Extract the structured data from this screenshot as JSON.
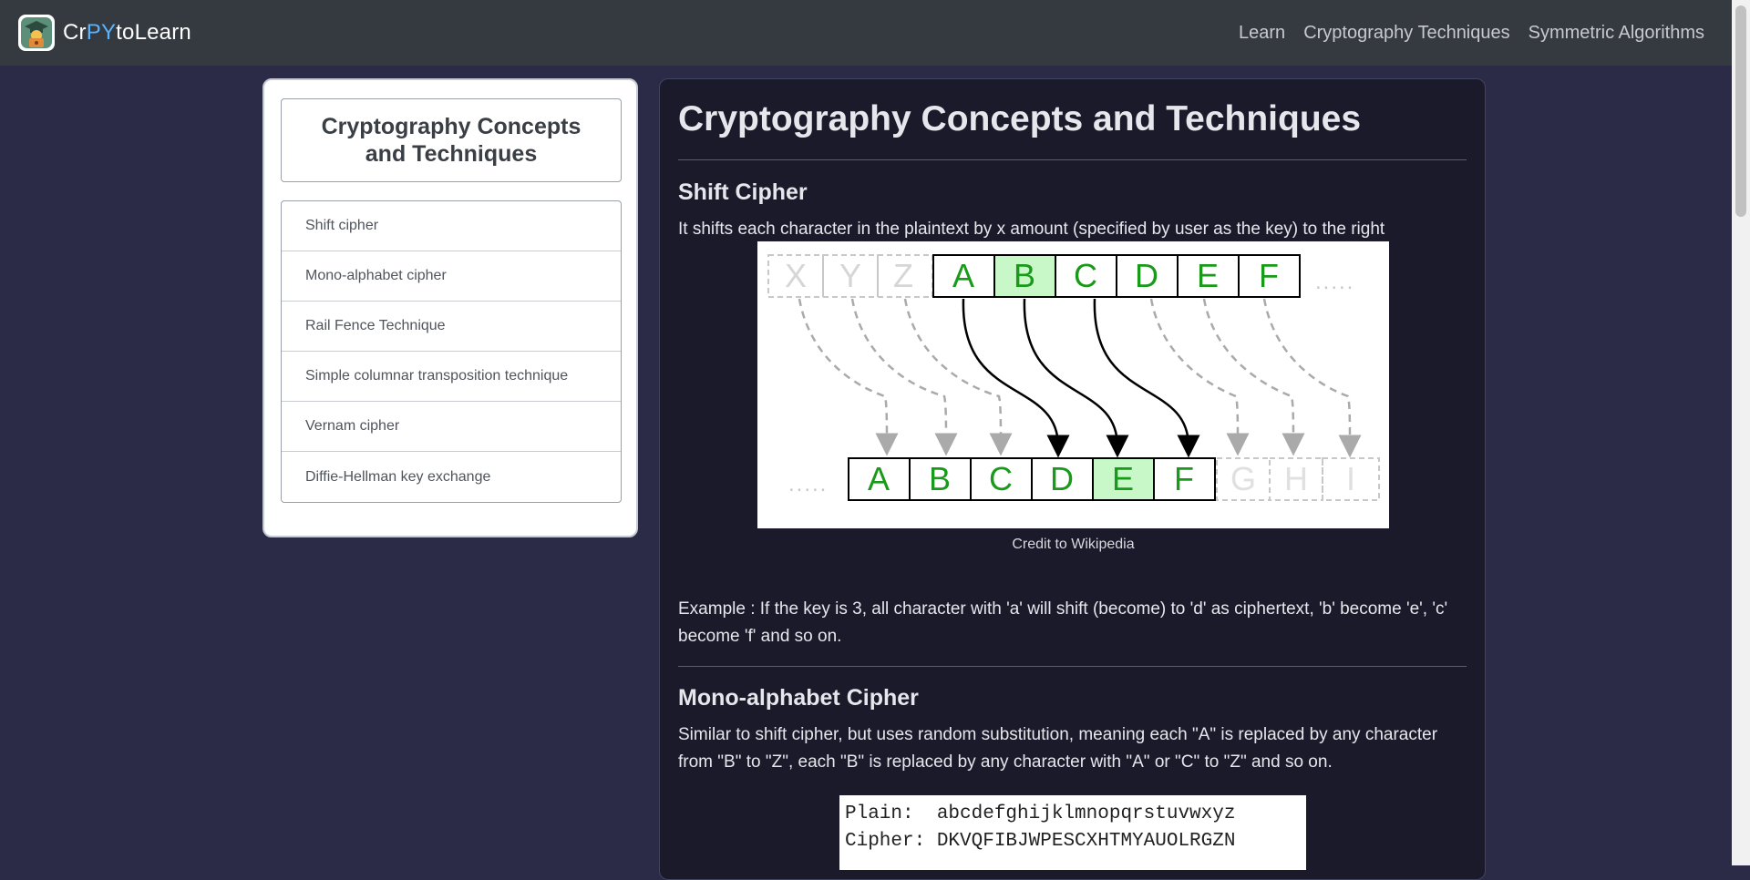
{
  "navbar": {
    "brand_prefix": "Cr",
    "brand_highlight": "PY",
    "brand_suffix": "toLearn",
    "links": [
      "Learn",
      "Cryptography Techniques",
      "Symmetric Algorithms"
    ]
  },
  "sidebar": {
    "title": "Cryptography Concepts and Techniques",
    "items": [
      "Shift cipher",
      "Mono-alphabet cipher",
      "Rail Fence Technique",
      "Simple columnar transposition technique",
      "Vernam cipher",
      "Diffie-Hellman key exchange"
    ]
  },
  "main": {
    "title": "Cryptography Concepts and Techniques",
    "shift": {
      "heading": "Shift Cipher",
      "description": "It shifts each character in the plaintext by x amount (specified by user as the key) to the right",
      "figure": {
        "top_faded": [
          "X",
          "Y",
          "Z"
        ],
        "top_letters": [
          "A",
          "B",
          "C",
          "D",
          "E",
          "F"
        ],
        "top_ellipsis": ".....",
        "bottom_ellipsis": ".....",
        "bottom_letters": [
          "A",
          "B",
          "C",
          "D",
          "E",
          "F"
        ],
        "bottom_faded": [
          "G",
          "H",
          "I"
        ]
      },
      "caption": "Credit to Wikipedia",
      "example": "Example : If the key is 3, all character with 'a' will shift (become) to 'd' as ciphertext, 'b' become 'e', 'c' become 'f' and so on."
    },
    "mono": {
      "heading": "Mono-alphabet Cipher",
      "description": "Similar to shift cipher, but uses random substitution, meaning each \"A\" is replaced by any character from \"B\" to \"Z\", each \"B\" is replaced by any character with \"A\" or \"C\" to \"Z\" and so on.",
      "image_lines": [
        "Plain:  abcdefghijklmnopqrstuvwxyz",
        "Cipher: DKVQFIBJWPESCXHTMYAUOLRGZN"
      ]
    }
  },
  "colors": {
    "page_bg": "#2c2b47",
    "navbar_bg": "#353a40",
    "main_card_bg": "#1b1a2b",
    "brand_py": "#5ab4ff",
    "cipher_green": "#1a9a1a",
    "highlight_green": "#c8f7c8"
  }
}
